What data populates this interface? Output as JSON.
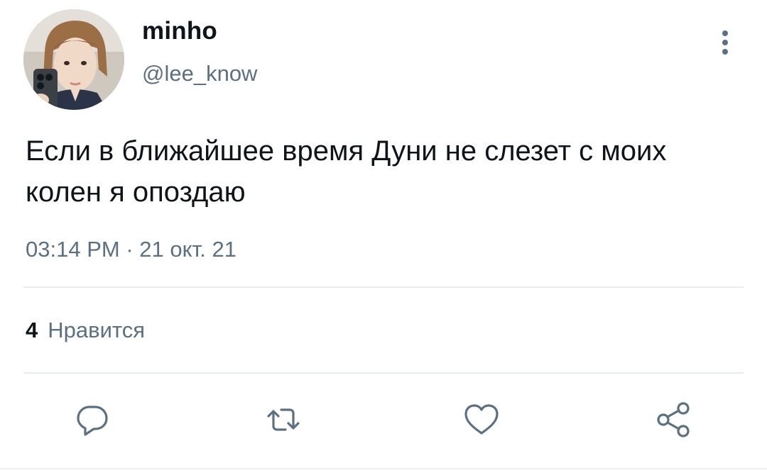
{
  "user": {
    "display_name": "minho",
    "handle": "@lee_know"
  },
  "tweet": {
    "text": "Если в ближайшее время Дуни не слезет с моих колен я опоздаю",
    "time": "03:14 PM",
    "separator": "·",
    "date": "21 окт. 21"
  },
  "stats": {
    "likes_count": "4",
    "likes_label": "Нравится"
  },
  "actions": [
    "reply-icon",
    "retweet-icon",
    "like-icon",
    "share-icon"
  ],
  "colors": {
    "text": "#0f1419",
    "secondary": "#5b7083",
    "divider": "#e6ecf0",
    "background": "#ffffff"
  }
}
